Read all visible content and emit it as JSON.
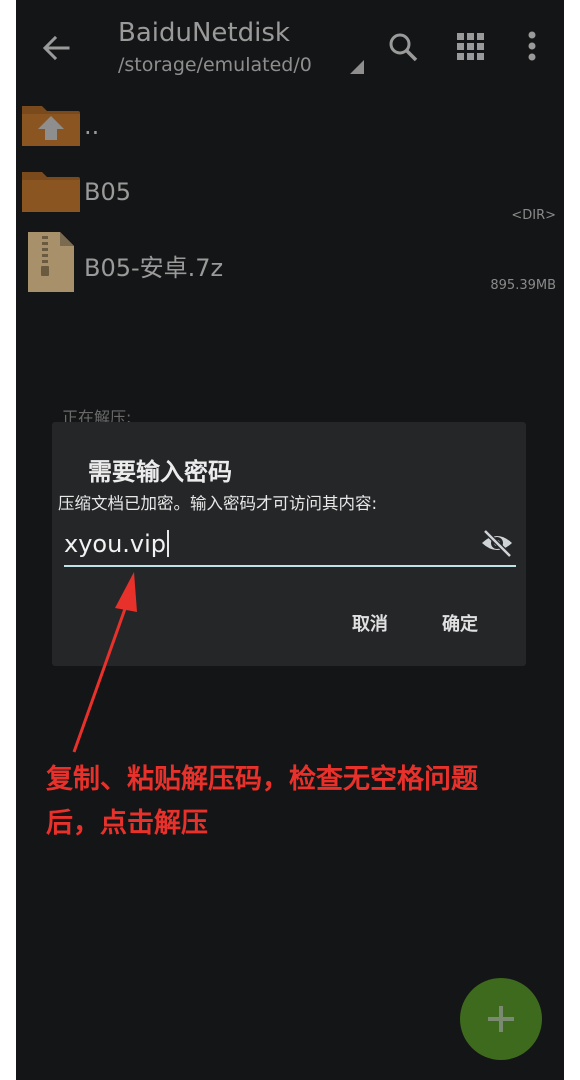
{
  "appbar": {
    "title": "BaiduNetdisk",
    "path": "/storage/emulated/0",
    "icons": [
      "back-arrow-icon",
      "search-icon",
      "grid-icon",
      "more-vert-icon"
    ]
  },
  "files": [
    {
      "name": "..",
      "meta": "",
      "icon": "folder-up-icon"
    },
    {
      "name": "B05",
      "meta": "<DIR>",
      "icon": "folder-icon"
    },
    {
      "name": "B05-安卓.7z",
      "meta": "895.39MB",
      "icon": "archive-icon"
    }
  ],
  "background_status": "正在解压:",
  "dialog": {
    "title": "需要输入密码",
    "message": "压缩文档已加密。输入密码才可访问其内容:",
    "password_value": "xyou.vip",
    "cancel_label": "取消",
    "ok_label": "确定"
  },
  "annotation": {
    "line1": "复制、粘贴解压码，检查无空格问题",
    "line2": "后，点击解压",
    "color": "#e8312b"
  },
  "fab": {
    "icon": "plus-icon",
    "color": "#3d6a1c"
  }
}
